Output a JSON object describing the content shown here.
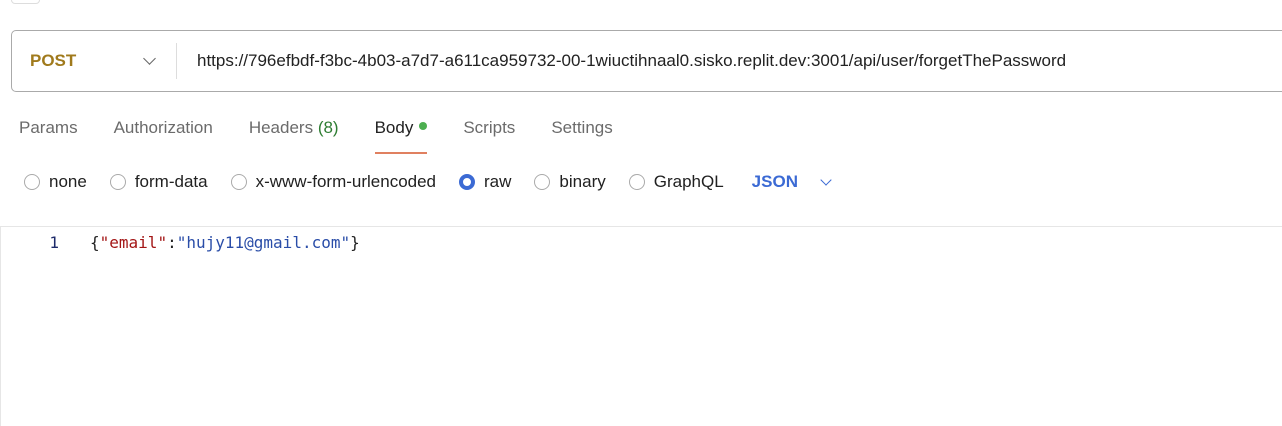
{
  "request": {
    "method": "POST",
    "url": "https://796efbdf-f3bc-4b03-a7d7-a611ca959732-00-1wiuctihnaal0.sisko.replit.dev:3001/api/user/forgetThePassword"
  },
  "tabs": {
    "params": "Params",
    "authorization": "Authorization",
    "headers": "Headers",
    "headers_count": "(8)",
    "body": "Body",
    "scripts": "Scripts",
    "settings": "Settings"
  },
  "body_types": {
    "none": "none",
    "form_data": "form-data",
    "urlencoded": "x-www-form-urlencoded",
    "raw": "raw",
    "binary": "binary",
    "graphql": "GraphQL",
    "selected": "raw",
    "language": "JSON"
  },
  "editor": {
    "line_number": "1",
    "open": "{",
    "key": "\"email\"",
    "colon": ":",
    "value": "\"hujy11@gmail.com\"",
    "close": "}"
  },
  "colors": {
    "method": "#a07a1c",
    "accent": "#3b6ad4",
    "tab_underline": "#e08060",
    "status_dot": "#4caf50"
  }
}
